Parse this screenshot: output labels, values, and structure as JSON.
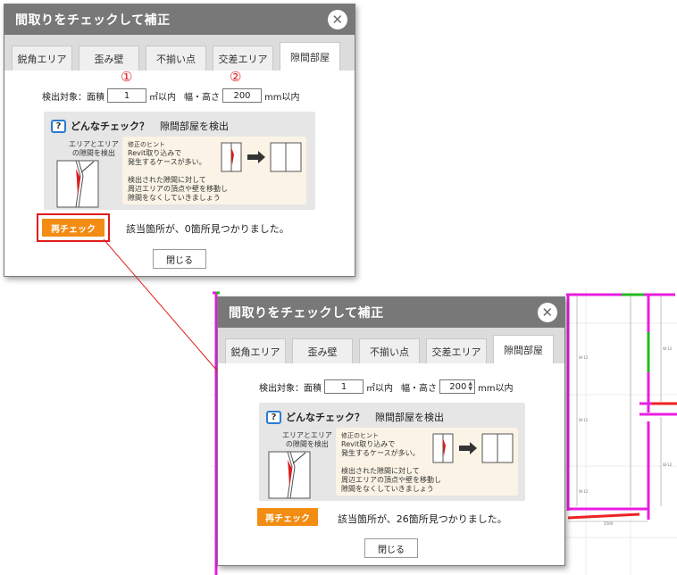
{
  "dialog": {
    "title": "間取りをチェックして補正",
    "close_glyph": "✕",
    "tabs": [
      "鋭角エリア",
      "歪み壁",
      "不揃い点",
      "交差エリア",
      "隙間部屋"
    ],
    "active_tab": "隙間部屋",
    "params": {
      "prefix": "検出対象：面積",
      "area_value": "1",
      "area_unit": "㎡以内",
      "size_label": "幅・高さ",
      "size_value": "200",
      "size_unit": "mm以内"
    },
    "hint": {
      "icon_glyph": "?",
      "heading": "どんなチェック？",
      "subheading": "隙間部屋を検出",
      "diagram_label_line1": "エリアとエリア",
      "diagram_label_line2": "の隙間を検出",
      "tip_title": "修正のヒント",
      "tip_line1": "Revit取り込みで",
      "tip_line2": "発生するケースが多い。",
      "tip_line3": "検出された隙間に対して",
      "tip_line4": "周辺エリアの頂点や壁を移動し",
      "tip_line5": "隙間をなくしていきましょう"
    },
    "recheck_label": "再チェック",
    "close_label": "閉じる"
  },
  "before": {
    "result": "該当箇所が、0箇所見つかりました。"
  },
  "after": {
    "result": "該当箇所が、26箇所見つかりました。"
  },
  "annotations": {
    "marker_1": "①",
    "marker_2": "②"
  },
  "colors": {
    "accent": "#f28c13",
    "highlight": "#e01b1b",
    "titlebar": "#787878",
    "icon_border": "#2b7bd3"
  }
}
